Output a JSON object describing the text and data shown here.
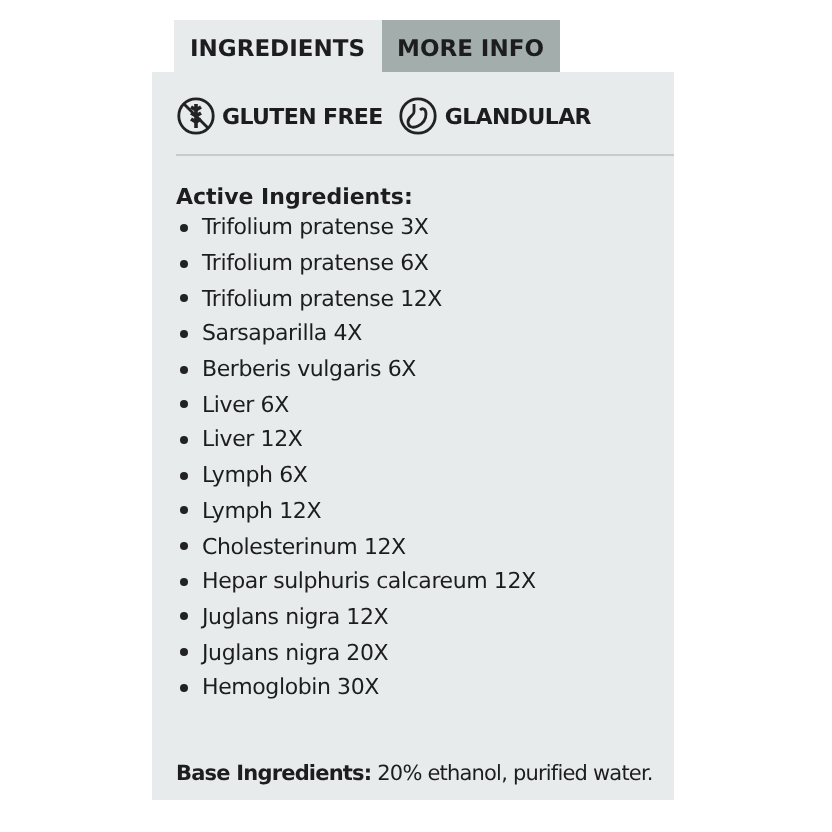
{
  "tabs": [
    {
      "label": "INGREDIENTS",
      "selected": true
    },
    {
      "label": "MORE INFO",
      "selected": false
    }
  ],
  "badges": [
    {
      "kind": "gluten-free",
      "label": "GLUTEN FREE"
    },
    {
      "kind": "glandular",
      "label": "GLANDULAR"
    }
  ],
  "active_heading": "Active Ingredients:",
  "ingredients": [
    "Trifolium pratense 3X",
    "Trifolium pratense 6X",
    "Trifolium pratense 12X",
    "Sarsaparilla 4X",
    "Berberis vulgaris 6X",
    "Liver 6X",
    "Liver 12X",
    "Lymph 6X",
    "Lymph 12X",
    "Cholesterinum 12X",
    "Hepar sulphuris calcareum 12X",
    "Juglans nigra 12X",
    "Juglans nigra 20X",
    "Hemoglobin 30X"
  ],
  "base_ingredients": "**Base Ingredients:** 20% ethanol, purified water."
}
